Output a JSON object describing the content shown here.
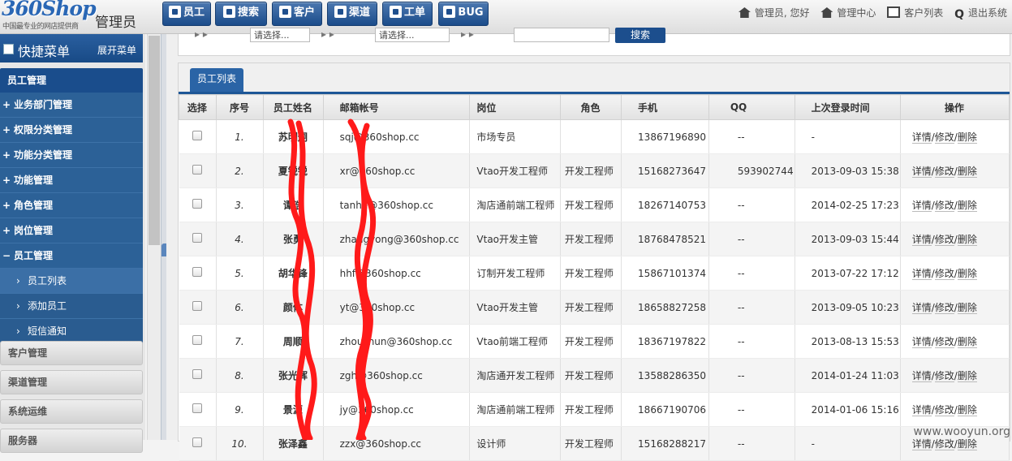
{
  "header": {
    "logo_brand": "360Shop",
    "logo_tagline": "中国最专业的网店提供商",
    "system_name": "管理员",
    "nav": [
      {
        "label": "员工",
        "icon": "employee-icon"
      },
      {
        "label": "搜索",
        "icon": "document-icon"
      },
      {
        "label": "客户",
        "icon": "pen-icon"
      },
      {
        "label": "渠道",
        "icon": "person-icon"
      },
      {
        "label": "工单",
        "icon": "chart-icon"
      },
      {
        "label": "BUG",
        "icon": "gear-icon"
      }
    ],
    "links": {
      "greeting": "管理员, 您好",
      "admin_center": "管理中心",
      "customer_list": "客户列表",
      "logout": "退出系统"
    }
  },
  "sidebar": {
    "quick_menu": "快捷菜单",
    "expand_menu": "展开菜单",
    "section_title": "员工管理",
    "items": [
      {
        "sign": "+",
        "label": "业务部门管理"
      },
      {
        "sign": "+",
        "label": "权限分类管理"
      },
      {
        "sign": "+",
        "label": "功能分类管理"
      },
      {
        "sign": "+",
        "label": "功能管理"
      },
      {
        "sign": "+",
        "label": "角色管理"
      },
      {
        "sign": "+",
        "label": "岗位管理"
      },
      {
        "sign": "−",
        "label": "员工管理"
      }
    ],
    "sub_items": [
      {
        "label": "员工列表"
      },
      {
        "label": "添加员工"
      },
      {
        "label": "短信通知"
      }
    ],
    "groups": [
      "客户管理",
      "渠道管理",
      "系统运维",
      "服务器"
    ]
  },
  "search": {
    "field1_value": "请选择...",
    "field2_value": "请选择...",
    "button": "搜索"
  },
  "main": {
    "tab_label": "员工列表",
    "columns": [
      "选择",
      "序号",
      "员工姓名",
      "邮箱帐号",
      "岗位",
      "角色",
      "手机",
      "QQ",
      "上次登录时间",
      "操作"
    ],
    "actions": {
      "detail": "详情",
      "edit": "修改",
      "delete": "删除",
      "sep": "/"
    },
    "rows": [
      {
        "idx": "1.",
        "name": "苏明炯",
        "email": "sqj@360shop.cc",
        "post": "市场专员",
        "role": "",
        "phone": "13867196890",
        "qq": "--",
        "last": "-"
      },
      {
        "idx": "2.",
        "name": "夏锐锐",
        "email": "xr@360shop.cc",
        "post": "Vtao开发工程师",
        "role": "开发工程师",
        "phone": "15168273647",
        "qq": "593902744",
        "last": "2013-09-03 15:38"
      },
      {
        "idx": "3.",
        "name": "谭浩",
        "email": "tanhe@360shop.cc",
        "post": "淘店通前端工程师",
        "role": "开发工程师",
        "phone": "18267140753",
        "qq": "--",
        "last": "2014-02-25 17:23"
      },
      {
        "idx": "4.",
        "name": "张勇",
        "email": "zhangyong@360shop.cc",
        "post": "Vtao开发主管",
        "role": "开发工程师",
        "phone": "18768478521",
        "qq": "--",
        "last": "2013-09-03 15:44"
      },
      {
        "idx": "5.",
        "name": "胡华锋",
        "email": "hhf@360shop.cc",
        "post": "订制开发工程师",
        "role": "开发工程师",
        "phone": "15867101374",
        "qq": "--",
        "last": "2013-07-22 17:12"
      },
      {
        "idx": "6.",
        "name": "颜体",
        "email": "yt@360shop.cc",
        "post": "Vtao开发主管",
        "role": "开发工程师",
        "phone": "18658827258",
        "qq": "--",
        "last": "2013-09-05 10:23"
      },
      {
        "idx": "7.",
        "name": "周顺",
        "email": "zhoushun@360shop.cc",
        "post": "Vtao前端工程师",
        "role": "开发工程师",
        "phone": "18367197822",
        "qq": "--",
        "last": "2013-08-13 15:53"
      },
      {
        "idx": "8.",
        "name": "张光辉",
        "email": "zgh@360shop.cc",
        "post": "淘店通开发工程师",
        "role": "开发工程师",
        "phone": "13588286350",
        "qq": "--",
        "last": "2014-01-24 11:03"
      },
      {
        "idx": "9.",
        "name": "景源",
        "email": "jy@360shop.cc",
        "post": "淘店通前端工程师",
        "role": "开发工程师",
        "phone": "18667190706",
        "qq": "--",
        "last": "2014-01-06 15:16"
      },
      {
        "idx": "10.",
        "name": "张泽鑫",
        "email": "zzx@360shop.cc",
        "post": "设计师",
        "role": "开发工程师",
        "phone": "15168288217",
        "qq": "--",
        "last": "-"
      }
    ]
  },
  "watermark": "www.wooyun.org",
  "colors": {
    "nav_blue": "#1b4c8a",
    "sidebar_blue": "#2c6197",
    "scribble_red": "#ff1a1a"
  }
}
